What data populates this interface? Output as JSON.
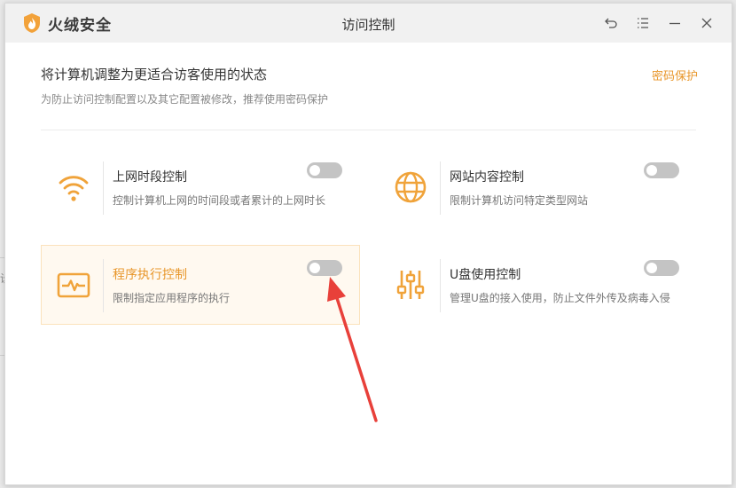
{
  "window": {
    "brand_name": "火绒安全",
    "title": "访问控制",
    "controls": [
      "back-icon",
      "menu-icon",
      "minimize-icon",
      "close-icon"
    ]
  },
  "header": {
    "headline": "将计算机调整为更适合访客使用的状态",
    "subline": "为防止访问控制配置以及其它配置被修改，推荐使用密码保护",
    "password_link": "密码保护"
  },
  "controls": [
    {
      "title": "上网时段控制",
      "desc": "控制计算机上网的时间段或者累计的上网时长",
      "icon": "wifi-icon",
      "enabled": false
    },
    {
      "title": "网站内容控制",
      "desc": "限制计算机访问特定类型网站",
      "icon": "globe-icon",
      "enabled": false
    },
    {
      "title": "程序执行控制",
      "desc": "限制指定应用程序的执行",
      "icon": "program-monitor-icon",
      "enabled": false,
      "highlighted": true
    },
    {
      "title": "U盘使用控制",
      "desc": "管理U盘的接入使用，防止文件外传及病毒入侵",
      "icon": "sliders-icon",
      "enabled": false
    }
  ],
  "colors": {
    "accent": "#e8962a",
    "toggle_off": "#c4c4c4",
    "highlight_bg": "#fff9f0",
    "annotation_arrow": "#e8403a"
  },
  "background": {
    "partial_text": "设"
  }
}
